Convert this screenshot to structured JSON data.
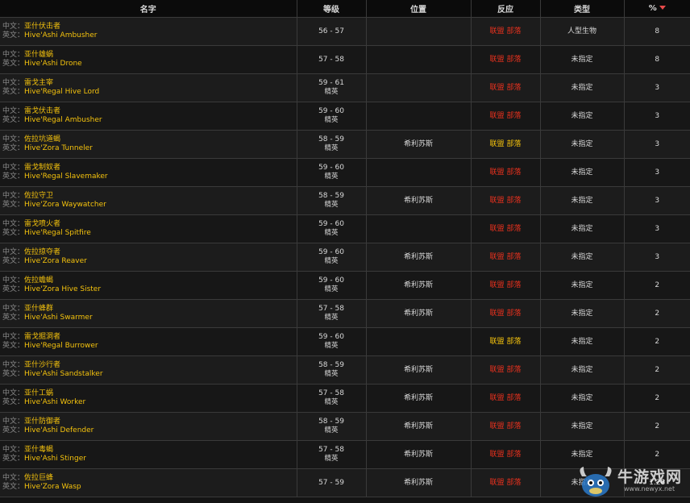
{
  "columns": {
    "name": "名字",
    "level": "等级",
    "location": "位置",
    "react": "反应",
    "type": "类型",
    "pct": "%"
  },
  "labels": {
    "cn": "中文：",
    "en": "英文：",
    "elite": "精英",
    "alliance": "联盟",
    "horde": "部落"
  },
  "colors": {
    "name": "#f4c20d",
    "hostile": "#e8311e",
    "neutral": "#f4c20d"
  },
  "rows": [
    {
      "cn": "亚什伏击者",
      "en": "Hive'Ashi Ambusher",
      "level": "56 - 57",
      "elite": "",
      "location": "",
      "react": "red",
      "type": "人型生物",
      "pct": "8"
    },
    {
      "cn": "亚什雄蜗",
      "en": "Hive'Ashi Drone",
      "level": "57 - 58",
      "elite": "",
      "location": "",
      "react": "red",
      "type": "未指定",
      "pct": "8"
    },
    {
      "cn": "雷戈主宰",
      "en": "Hive'Regal Hive Lord",
      "level": "59 - 61",
      "elite": "精英",
      "location": "",
      "react": "red",
      "type": "未指定",
      "pct": "3"
    },
    {
      "cn": "雷戈伏击者",
      "en": "Hive'Regal Ambusher",
      "level": "59 - 60",
      "elite": "精英",
      "location": "",
      "react": "red",
      "type": "未指定",
      "pct": "3"
    },
    {
      "cn": "佐拉坑道蝎",
      "en": "Hive'Zora Tunneler",
      "level": "58 - 59",
      "elite": "精英",
      "location": "希利苏斯",
      "react": "yellow",
      "type": "未指定",
      "pct": "3"
    },
    {
      "cn": "雷戈制奴者",
      "en": "Hive'Regal Slavemaker",
      "level": "59 - 60",
      "elite": "精英",
      "location": "",
      "react": "red",
      "type": "未指定",
      "pct": "3"
    },
    {
      "cn": "佐拉守卫",
      "en": "Hive'Zora Waywatcher",
      "level": "58 - 59",
      "elite": "精英",
      "location": "希利苏斯",
      "react": "red",
      "type": "未指定",
      "pct": "3"
    },
    {
      "cn": "雷戈喷火者",
      "en": "Hive'Regal Spitfire",
      "level": "59 - 60",
      "elite": "精英",
      "location": "",
      "react": "red",
      "type": "未指定",
      "pct": "3"
    },
    {
      "cn": "佐拉掠夺者",
      "en": "Hive'Zora Reaver",
      "level": "59 - 60",
      "elite": "精英",
      "location": "希利苏斯",
      "react": "red",
      "type": "未指定",
      "pct": "3"
    },
    {
      "cn": "佐拉蟾蝎",
      "en": "Hive'Zora Hive Sister",
      "level": "59 - 60",
      "elite": "精英",
      "location": "希利苏斯",
      "react": "red",
      "type": "未指定",
      "pct": "2"
    },
    {
      "cn": "亚什蜂群",
      "en": "Hive'Ashi Swarmer",
      "level": "57 - 58",
      "elite": "精英",
      "location": "希利苏斯",
      "react": "red",
      "type": "未指定",
      "pct": "2"
    },
    {
      "cn": "雷戈掘洞者",
      "en": "Hive'Regal Burrower",
      "level": "59 - 60",
      "elite": "精英",
      "location": "",
      "react": "yellow",
      "type": "未指定",
      "pct": "2"
    },
    {
      "cn": "亚什沙行者",
      "en": "Hive'Ashi Sandstalker",
      "level": "58 - 59",
      "elite": "精英",
      "location": "希利苏斯",
      "react": "red",
      "type": "未指定",
      "pct": "2"
    },
    {
      "cn": "亚什工蜗",
      "en": "Hive'Ashi Worker",
      "level": "57 - 58",
      "elite": "精英",
      "location": "希利苏斯",
      "react": "red",
      "type": "未指定",
      "pct": "2"
    },
    {
      "cn": "亚什防御者",
      "en": "Hive'Ashi Defender",
      "level": "58 - 59",
      "elite": "精英",
      "location": "希利苏斯",
      "react": "red",
      "type": "未指定",
      "pct": "2"
    },
    {
      "cn": "亚什毒蝎",
      "en": "Hive'Ashi Stinger",
      "level": "57 - 58",
      "elite": "精英",
      "location": "希利苏斯",
      "react": "red",
      "type": "未指定",
      "pct": "2"
    },
    {
      "cn": "佐拉巨蜂",
      "en": "Hive'Zora Wasp",
      "level": "57 - 59",
      "elite": "",
      "location": "希利苏斯",
      "react": "red",
      "type": "未指定",
      "pct": "1.28"
    }
  ],
  "watermark": {
    "title": "牛游戏网",
    "url": "www.newyx.net"
  }
}
